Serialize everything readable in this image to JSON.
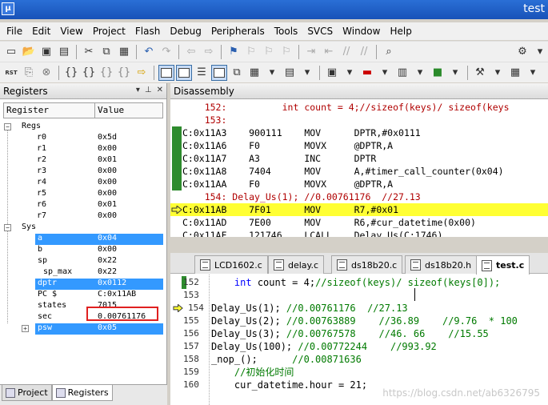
{
  "window": {
    "title": "test"
  },
  "menu": [
    "File",
    "Edit",
    "View",
    "Project",
    "Flash",
    "Debug",
    "Peripherals",
    "Tools",
    "SVCS",
    "Window",
    "Help"
  ],
  "toolbar2": {
    "rst_label": "RST"
  },
  "registers_pane": {
    "title": "Registers",
    "col_register": "Register",
    "col_value": "Value",
    "groups": [
      {
        "name": "Regs",
        "expander": "−",
        "items": [
          {
            "name": "r0",
            "value": "0x5d"
          },
          {
            "name": "r1",
            "value": "0x00"
          },
          {
            "name": "r2",
            "value": "0x01"
          },
          {
            "name": "r3",
            "value": "0x00"
          },
          {
            "name": "r4",
            "value": "0x00"
          },
          {
            "name": "r5",
            "value": "0x00"
          },
          {
            "name": "r6",
            "value": "0x01"
          },
          {
            "name": "r7",
            "value": "0x00"
          }
        ]
      },
      {
        "name": "Sys",
        "expander": "−",
        "items": [
          {
            "name": "a",
            "value": "0x04",
            "selected": true
          },
          {
            "name": "b",
            "value": "0x00"
          },
          {
            "name": "sp",
            "value": "0x22"
          },
          {
            "name": "sp_max",
            "value": "0x22"
          },
          {
            "name": "dptr",
            "value": "0x0112",
            "selected": true
          },
          {
            "name": "PC  $",
            "value": "C:0x11AB"
          },
          {
            "name": "states",
            "value": "7015"
          },
          {
            "name": "sec",
            "value": "0.00761176"
          },
          {
            "name": "psw",
            "value": "0x05",
            "selected": true,
            "expander": "+"
          }
        ]
      }
    ]
  },
  "bottom_tabs": [
    "Project",
    "Registers"
  ],
  "disassembly": {
    "title": "Disassembly",
    "lines": [
      {
        "kind": "src",
        "text": "    152:          int count = 4;//sizeof(keys)/ sizeof(keys"
      },
      {
        "kind": "src",
        "text": "    153:"
      },
      {
        "kind": "asm",
        "text": "C:0x11A3    900111    MOV      DPTR,#0x0111",
        "green": true
      },
      {
        "kind": "asm",
        "text": "C:0x11A6    F0        MOVX     @DPTR,A",
        "green": true
      },
      {
        "kind": "asm",
        "text": "C:0x11A7    A3        INC      DPTR",
        "green": true
      },
      {
        "kind": "asm",
        "text": "C:0x11A8    7404      MOV      A,#timer_call_counter(0x04)",
        "green": true
      },
      {
        "kind": "asm",
        "text": "C:0x11AA    F0        MOVX     @DPTR,A",
        "green": true
      },
      {
        "kind": "src",
        "text": "    154: Delay_Us(1); //0.00761176  //27.13"
      },
      {
        "kind": "cur",
        "text": "C:0x11AB    7F01      MOV      R7,#0x01"
      },
      {
        "kind": "asm",
        "text": "C:0x11AD    7E00      MOV      R6,#cur_datetime(0x00)"
      },
      {
        "kind": "asm",
        "text": "C:0x11AF    121746    LCALL    Delay_Us(C:1746)"
      }
    ]
  },
  "editor": {
    "tabs": [
      "LCD1602.c",
      "delay.c",
      "ds18b20.c",
      "ds18b20.h",
      "test.c"
    ],
    "active_tab": "test.c",
    "lines": [
      {
        "num": "152",
        "parts": [
          [
            "",
            "    "
          ],
          [
            "kw",
            "int"
          ],
          [
            "",
            " count = 4;"
          ],
          [
            "cm",
            "//sizeof(keys)/ sizeof(keys[0]);"
          ]
        ],
        "marker": true
      },
      {
        "num": "153",
        "parts": [
          [
            "",
            ""
          ]
        ]
      },
      {
        "num": "154",
        "parts": [
          [
            "",
            "Delay_Us(1); "
          ],
          [
            "cm",
            "//0.00761176  //27.13"
          ]
        ],
        "current": true
      },
      {
        "num": "155",
        "parts": [
          [
            "",
            "Delay_Us(2); "
          ],
          [
            "cm",
            "//0.00763889    //36.89    //9.76  * 100"
          ]
        ]
      },
      {
        "num": "156",
        "parts": [
          [
            "",
            "Delay_Us(3); "
          ],
          [
            "cm",
            "//0.00767578    //46. 66    //15.55"
          ]
        ]
      },
      {
        "num": "157",
        "parts": [
          [
            "",
            "Delay_Us(100); "
          ],
          [
            "cm",
            "//0.00772244    //993.92"
          ]
        ]
      },
      {
        "num": "158",
        "parts": [
          [
            "",
            "_nop_();      "
          ],
          [
            "cm",
            "//0.00871636"
          ]
        ]
      },
      {
        "num": "159",
        "parts": [
          [
            "cm",
            "    //初始化时间"
          ]
        ]
      },
      {
        "num": "160",
        "parts": [
          [
            "",
            "    cur_datetime.hour = 21;"
          ]
        ]
      }
    ]
  },
  "watermark": "https://blog.csdn.net/ab6326795",
  "colors": {
    "selection": "#3399ff",
    "current_line": "#ffff33",
    "exec_marker": "#2e8b2e",
    "comment": "#007a00",
    "keyword": "#0000ff",
    "highlight_box": "#e02020"
  }
}
